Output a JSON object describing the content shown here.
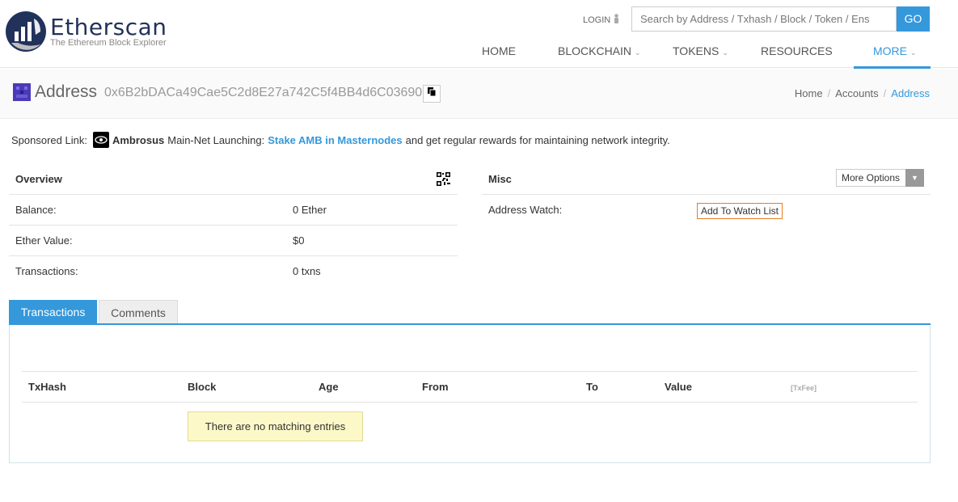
{
  "header": {
    "logo_title": "Etherscan",
    "logo_subtitle": "The Ethereum Block Explorer",
    "login_label": "LOGIN",
    "search_placeholder": "Search by Address / Txhash / Block / Token / Ens",
    "search_button": "GO",
    "nav": {
      "home": "HOME",
      "blockchain": "BLOCKCHAIN",
      "tokens": "TOKENS",
      "resources": "RESOURCES",
      "more": "MORE"
    }
  },
  "titlebar": {
    "label": "Address",
    "address": "0x6B2bDACa49Cae5C2d8E27a742C5f4BB4d6C03690",
    "breadcrumb": [
      "Home",
      "Accounts",
      "Address"
    ]
  },
  "sponsored": {
    "prefix": "Sponsored Link:",
    "brand": "Ambrosus",
    "text1": "Main-Net Launching:",
    "link": "Stake AMB in Masternodes",
    "text2": "and get regular rewards for maintaining network integrity."
  },
  "overview": {
    "title": "Overview",
    "rows": [
      {
        "label": "Balance:",
        "value": "0 Ether"
      },
      {
        "label": "Ether Value:",
        "value": "$0"
      },
      {
        "label": "Transactions:",
        "value": "0 txns"
      }
    ]
  },
  "misc": {
    "title": "Misc",
    "more_options": "More Options",
    "watch_label": "Address Watch:",
    "watch_button": "Add To Watch List"
  },
  "tabs": [
    "Transactions",
    "Comments"
  ],
  "table": {
    "columns": [
      "TxHash",
      "Block",
      "Age",
      "From",
      "To",
      "Value",
      "[TxFee]"
    ],
    "empty_message": "There are no matching entries"
  },
  "colors": {
    "accent": "#3498db",
    "brand_dark": "#21325b",
    "watch_border": "#e67e22",
    "empty_bg": "#fcf8c8"
  }
}
